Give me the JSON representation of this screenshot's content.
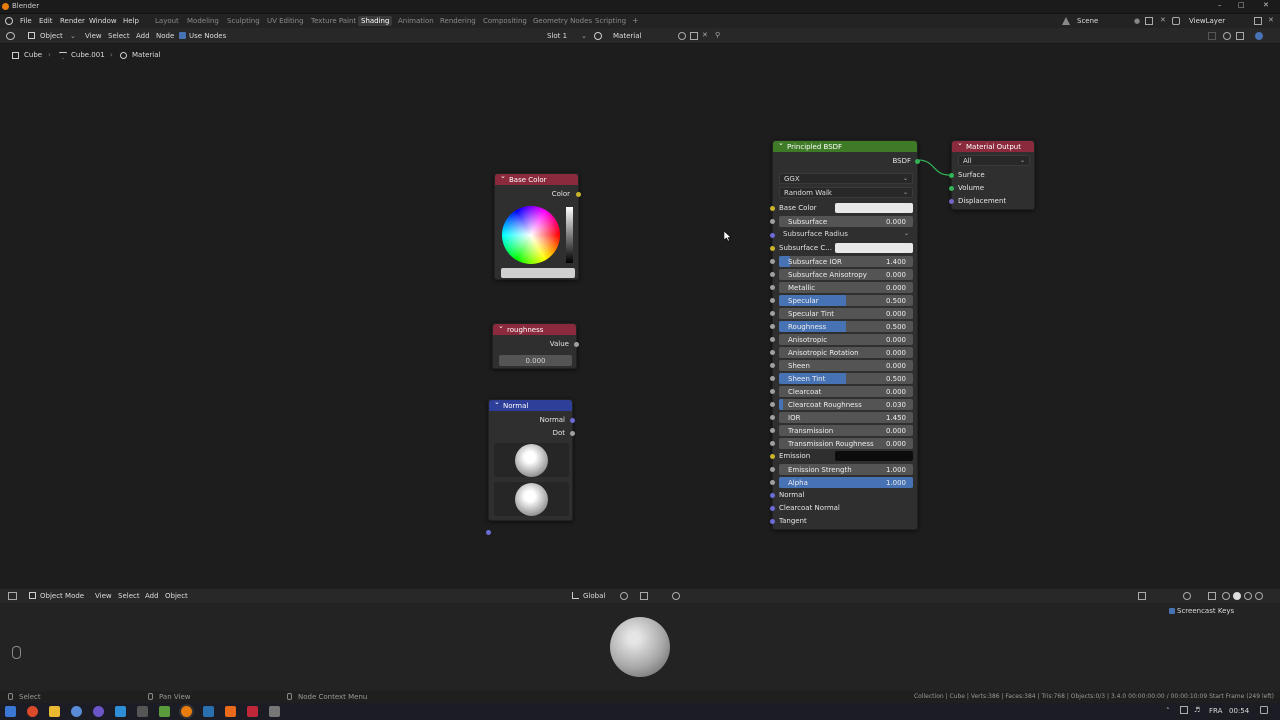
{
  "window": {
    "title": "Blender"
  },
  "topbar": {
    "menus": [
      "File",
      "Edit",
      "Render",
      "Window",
      "Help"
    ],
    "workspaces": [
      "Layout",
      "Modeling",
      "Sculpting",
      "UV Editing",
      "Texture Paint",
      "Shading",
      "Animation",
      "Rendering",
      "Compositing",
      "Geometry Nodes",
      "Scripting"
    ],
    "active_workspace": "Shading",
    "add_tab": "+",
    "scene": "Scene",
    "viewlayer": "ViewLayer"
  },
  "node_header": {
    "mode": "Object",
    "menus": [
      "View",
      "Select",
      "Add",
      "Node"
    ],
    "use_nodes": "Use Nodes",
    "slot": "Slot 1",
    "material": "Material"
  },
  "breadcrumb": {
    "object": "Cube",
    "mesh": "Cube.001",
    "material": "Material"
  },
  "nodes": {
    "base_color": {
      "title": "Base Color",
      "output": "Color"
    },
    "roughness": {
      "title": "roughness",
      "output": "Value",
      "value": "0.000"
    },
    "normal": {
      "title": "Normal",
      "out_normal": "Normal",
      "out_dot": "Dot"
    },
    "bsdf": {
      "title": "Principled BSDF",
      "output": "BSDF",
      "dist": "GGX",
      "sss": "Random Walk",
      "base_color": "Base Color",
      "subsurface_color": "Subsurface C...",
      "subsurface_radius": "Subsurface Radius",
      "emission": "Emission",
      "fields": [
        {
          "name": "Subsurface",
          "value": "0.000",
          "fill": 0
        },
        {
          "name": "Subsurface IOR",
          "value": "1.400",
          "fill": 0.08
        },
        {
          "name": "Subsurface Anisotropy",
          "value": "0.000",
          "fill": 0
        },
        {
          "name": "Metallic",
          "value": "0.000",
          "fill": 0
        },
        {
          "name": "Specular",
          "value": "0.500",
          "fill": 0.5
        },
        {
          "name": "Specular Tint",
          "value": "0.000",
          "fill": 0
        },
        {
          "name": "Roughness",
          "value": "0.500",
          "fill": 0.5
        },
        {
          "name": "Anisotropic",
          "value": "0.000",
          "fill": 0
        },
        {
          "name": "Anisotropic Rotation",
          "value": "0.000",
          "fill": 0
        },
        {
          "name": "Sheen",
          "value": "0.000",
          "fill": 0
        },
        {
          "name": "Sheen Tint",
          "value": "0.500",
          "fill": 0.5
        },
        {
          "name": "Clearcoat",
          "value": "0.000",
          "fill": 0
        },
        {
          "name": "Clearcoat Roughness",
          "value": "0.030",
          "fill": 0.03
        },
        {
          "name": "IOR",
          "value": "1.450",
          "fill": 0
        },
        {
          "name": "Transmission",
          "value": "0.000",
          "fill": 0
        },
        {
          "name": "Transmission Roughness",
          "value": "0.000",
          "fill": 0
        }
      ],
      "emission_strength": {
        "name": "Emission Strength",
        "value": "1.000"
      },
      "alpha": {
        "name": "Alpha",
        "value": "1.000",
        "fill": 1
      },
      "inputs_bottom": [
        "Normal",
        "Clearcoat Normal",
        "Tangent"
      ]
    },
    "output": {
      "title": "Material Output",
      "target": "All",
      "inputs": [
        "Surface",
        "Volume",
        "Displacement"
      ]
    }
  },
  "viewport_header": {
    "mode": "Object Mode",
    "menus": [
      "View",
      "Select",
      "Add",
      "Object"
    ],
    "transform": "Global",
    "overlay_label": "Screencast Keys"
  },
  "statusbar": {
    "select": "Select",
    "pan": "Pan View",
    "context": "Node Context Menu",
    "stats": "Collection | Cube | Verts:386 | Faces:384 | Tris:768 | Objects:0/3 | 3.4.0 00:00:00:00 / 00:00:10:09 Start Frame (249 left)"
  },
  "taskbar": {
    "lang": "FRA",
    "time": "00:54"
  }
}
